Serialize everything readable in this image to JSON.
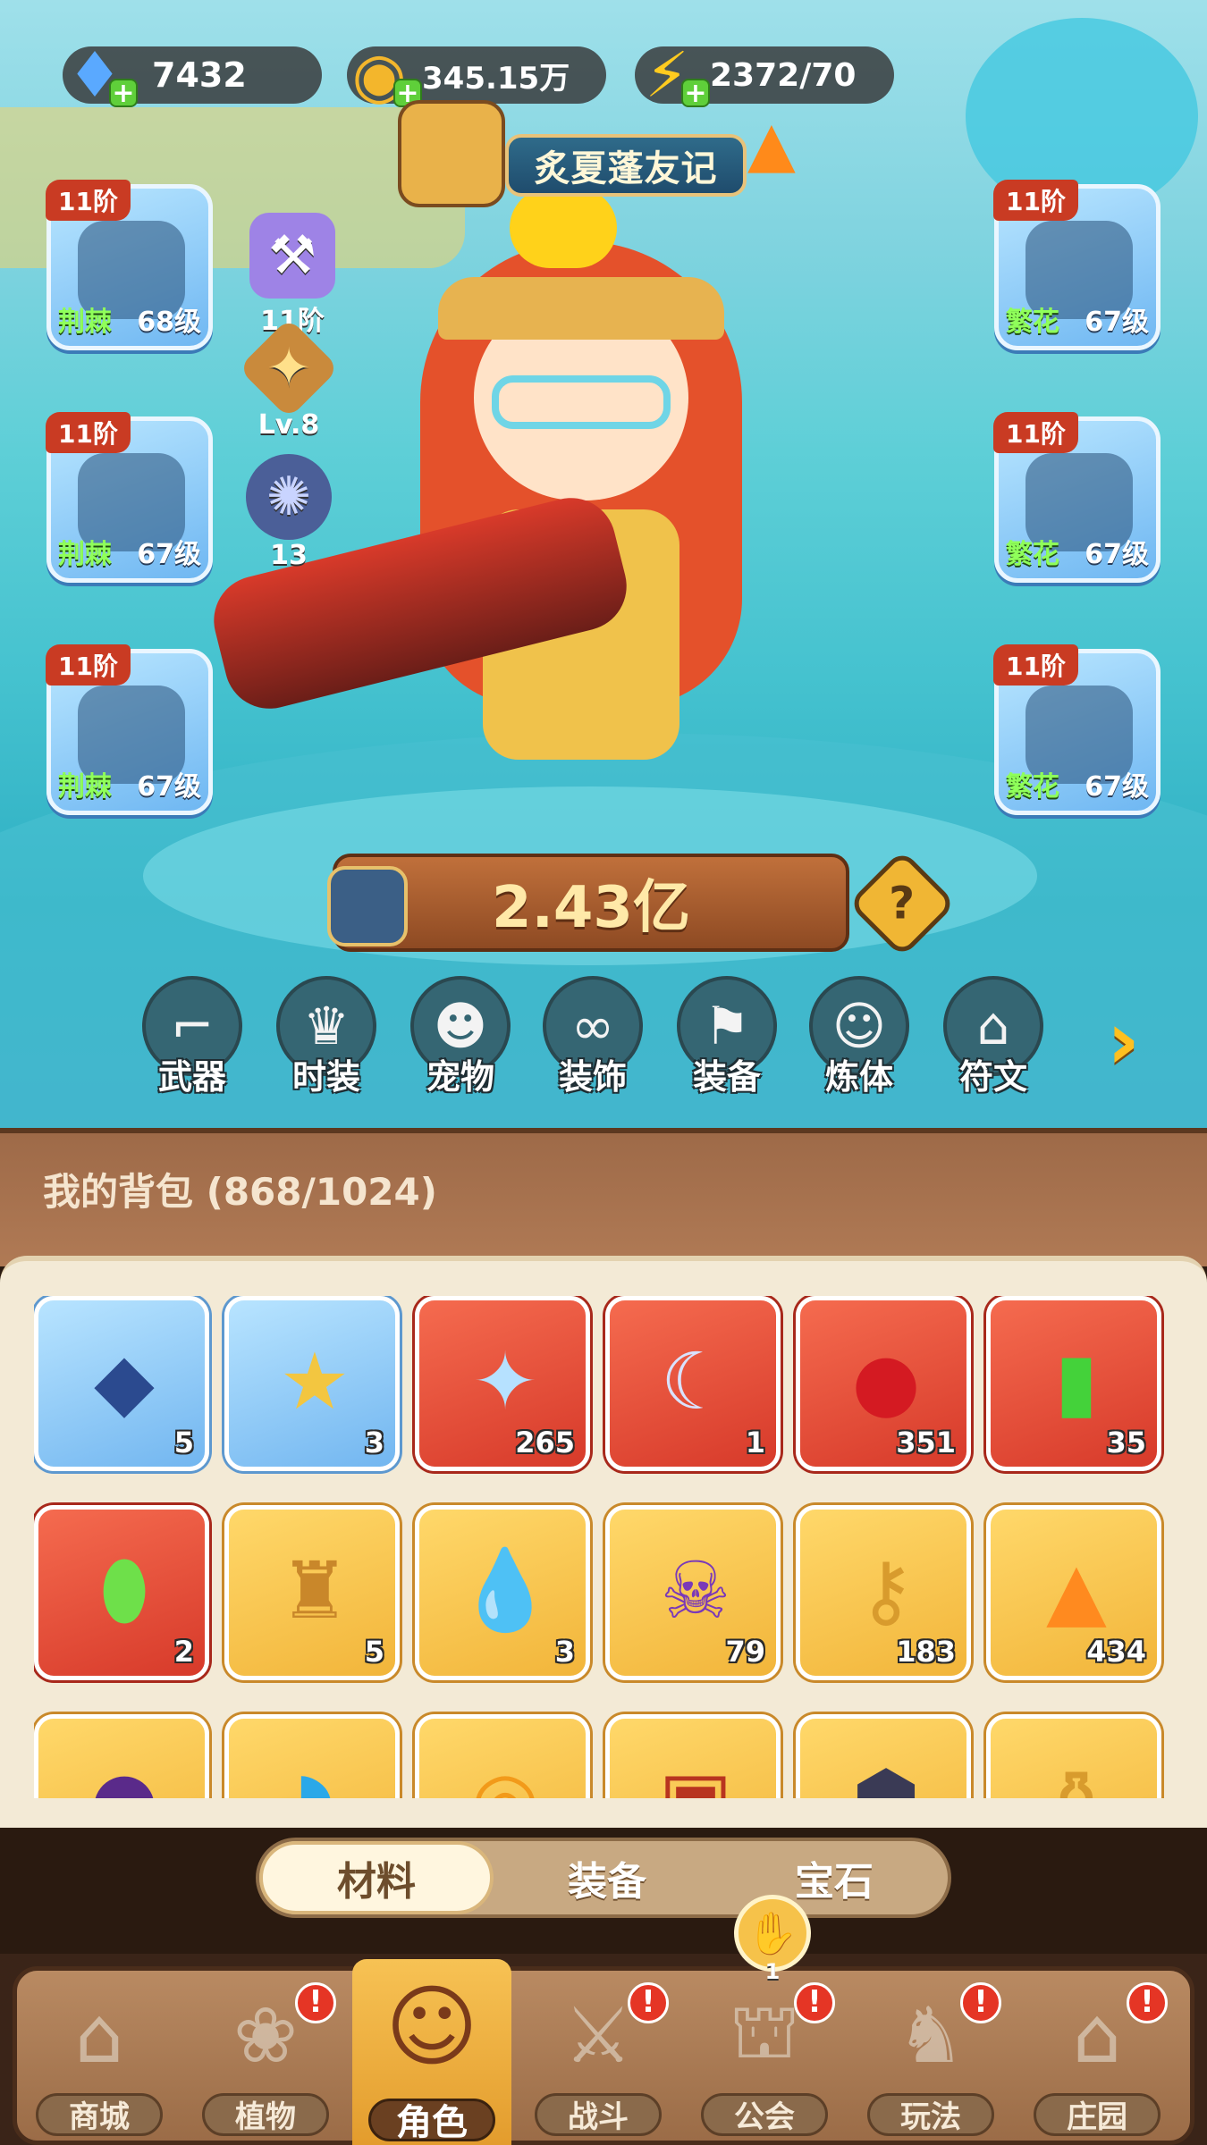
{
  "hud": {
    "diamond": {
      "icon": "diamond-icon",
      "value": "7432"
    },
    "gold": {
      "icon": "coin-icon",
      "value": "345.15万"
    },
    "energy": {
      "icon": "lightning-icon",
      "value": "2372/70"
    }
  },
  "event_banner": "炙夏蓬友记",
  "equipment_left": [
    {
      "tier": "11阶",
      "set": "荆棘",
      "level": "68级",
      "icon": "hat-icon"
    },
    {
      "tier": "11阶",
      "set": "荆棘",
      "level": "67级",
      "icon": "gloves-icon"
    },
    {
      "tier": "11阶",
      "set": "荆棘",
      "level": "67级",
      "icon": "shorts-icon"
    }
  ],
  "equipment_right": [
    {
      "tier": "11阶",
      "set": "繁花",
      "level": "67级",
      "icon": "shirt-icon"
    },
    {
      "tier": "11阶",
      "set": "繁花",
      "level": "67级",
      "icon": "belt-icon"
    },
    {
      "tier": "11阶",
      "set": "繁花",
      "level": "67级",
      "icon": "boots-icon"
    }
  ],
  "side_stats": [
    {
      "label": "11阶",
      "icon": "hammer-icon"
    },
    {
      "label": "Lv.8",
      "icon": "star-crystal-icon"
    },
    {
      "label": "13",
      "icon": "orb-icon"
    }
  ],
  "power": "2.43亿",
  "categories": [
    "武器",
    "时装",
    "宠物",
    "装饰",
    "装备",
    "炼体",
    "符文"
  ],
  "bag": {
    "title": "我的背包",
    "count": "(868/1024)",
    "items": [
      {
        "rarity": "blue",
        "icon": "mask-icon",
        "qty": "5"
      },
      {
        "rarity": "blue",
        "icon": "star-badge-icon",
        "qty": "3"
      },
      {
        "rarity": "red",
        "icon": "crystal-star-icon",
        "qty": "265"
      },
      {
        "rarity": "red",
        "icon": "moon-star-icon",
        "qty": "1"
      },
      {
        "rarity": "red",
        "icon": "potion-icon",
        "qty": "351"
      },
      {
        "rarity": "red",
        "icon": "tube-icon",
        "qty": "35"
      },
      {
        "rarity": "red",
        "icon": "green-capsule-icon",
        "qty": "2"
      },
      {
        "rarity": "gold",
        "icon": "gold-flask-icon",
        "qty": "5"
      },
      {
        "rarity": "gold",
        "icon": "water-drop-icon",
        "qty": "3"
      },
      {
        "rarity": "gold",
        "icon": "skull-scroll-icon",
        "qty": "79"
      },
      {
        "rarity": "gold",
        "icon": "key-icon",
        "qty": "183"
      },
      {
        "rarity": "gold",
        "icon": "pyramid-crystal-icon",
        "qty": "434"
      },
      {
        "rarity": "gold",
        "icon": "purple-orb-icon",
        "qty": ""
      },
      {
        "rarity": "gold",
        "icon": "blue-slime-icon",
        "qty": ""
      },
      {
        "rarity": "gold",
        "icon": "gold-ring-icon",
        "qty": ""
      },
      {
        "rarity": "gold",
        "icon": "chest-icon",
        "qty": ""
      },
      {
        "rarity": "gold",
        "icon": "dark-stone-icon",
        "qty": ""
      },
      {
        "rarity": "gold",
        "icon": "gold-bottle-icon",
        "qty": ""
      }
    ]
  },
  "bag_tabs": [
    "材料",
    "装备",
    "宝石"
  ],
  "guild_badge": "1",
  "nav": [
    {
      "label": "商城",
      "icon": "shop-icon",
      "alert": ""
    },
    {
      "label": "植物",
      "icon": "plant-icon",
      "alert": "!"
    },
    {
      "label": "角色",
      "icon": "character-icon",
      "alert": ""
    },
    {
      "label": "战斗",
      "icon": "battle-icon",
      "alert": "!"
    },
    {
      "label": "公会",
      "icon": "guild-icon",
      "alert": "!"
    },
    {
      "label": "玩法",
      "icon": "gameplay-icon",
      "alert": "!"
    },
    {
      "label": "庄园",
      "icon": "manor-icon",
      "alert": "!"
    }
  ]
}
